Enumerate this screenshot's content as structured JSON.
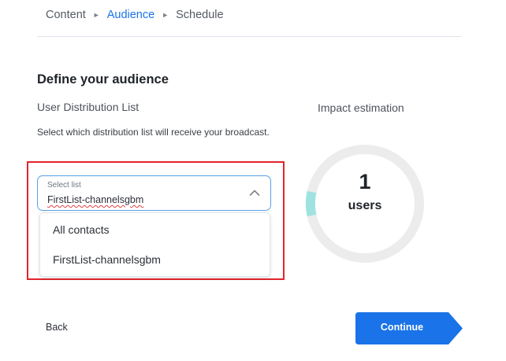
{
  "breadcrumb": {
    "items": [
      {
        "label": "Content",
        "active": false
      },
      {
        "label": "Audience",
        "active": true
      },
      {
        "label": "Schedule",
        "active": false
      }
    ],
    "separator": "►"
  },
  "audience": {
    "heading": "Define your audience",
    "list_label": "User Distribution List",
    "description": "Select which distribution list will receive your broadcast.",
    "select": {
      "label": "Select list",
      "value": "FirstList-channelsgbm",
      "chevron_icon": "chevron-up-icon"
    },
    "options": [
      "All contacts",
      "FirstList-channelsgbm"
    ]
  },
  "impact": {
    "label": "Impact estimation",
    "count": "1",
    "unit": "users"
  },
  "footer": {
    "back_label": "Back",
    "continue_label": "Continue"
  },
  "colors": {
    "accent": "#1a73e8",
    "highlight": "#e3242b",
    "ring_track": "#ececec",
    "ring_accent": "#9fe3e0"
  }
}
